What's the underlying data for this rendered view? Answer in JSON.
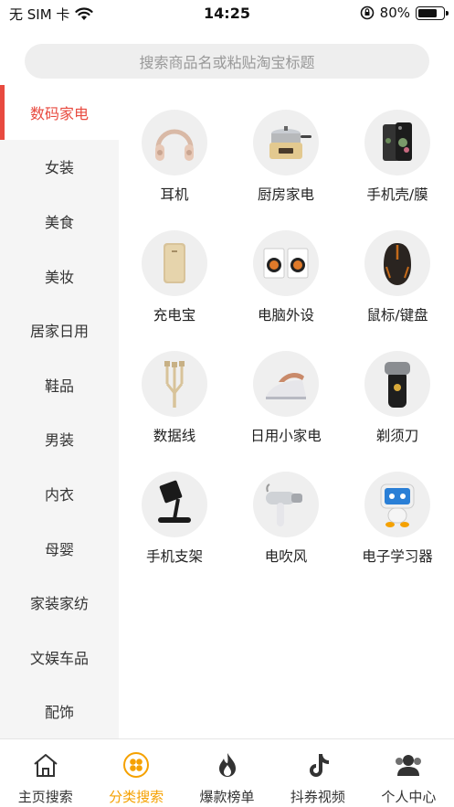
{
  "status_bar": {
    "carrier": "无 SIM 卡",
    "time": "14:25",
    "battery_percent": "80%",
    "battery_level": 0.8
  },
  "search": {
    "placeholder": "搜索商品名或粘贴淘宝标题"
  },
  "sidebar": {
    "items": [
      {
        "label": "数码家电",
        "active": true
      },
      {
        "label": "女装"
      },
      {
        "label": "美食"
      },
      {
        "label": "美妆"
      },
      {
        "label": "居家日用"
      },
      {
        "label": "鞋品"
      },
      {
        "label": "男装"
      },
      {
        "label": "内衣"
      },
      {
        "label": "母婴"
      },
      {
        "label": "家装家纺"
      },
      {
        "label": "文娱车品"
      },
      {
        "label": "配饰"
      }
    ]
  },
  "grid": {
    "items": [
      {
        "label": "耳机",
        "icon": "headphones-icon"
      },
      {
        "label": "厨房家电",
        "icon": "cooker-icon"
      },
      {
        "label": "手机壳/膜",
        "icon": "phone-case-icon"
      },
      {
        "label": "充电宝",
        "icon": "power-bank-icon"
      },
      {
        "label": "电脑外设",
        "icon": "speakers-icon"
      },
      {
        "label": "鼠标/键盘",
        "icon": "mouse-icon"
      },
      {
        "label": "数据线",
        "icon": "cable-icon"
      },
      {
        "label": "日用小家电",
        "icon": "iron-icon"
      },
      {
        "label": "剃须刀",
        "icon": "shaver-icon"
      },
      {
        "label": "手机支架",
        "icon": "phone-stand-icon"
      },
      {
        "label": "电吹风",
        "icon": "hair-dryer-icon"
      },
      {
        "label": "电子学习器",
        "icon": "learning-robot-icon"
      }
    ]
  },
  "tabbar": {
    "tabs": [
      {
        "label": "主页搜索",
        "icon": "home-icon"
      },
      {
        "label": "分类搜索",
        "icon": "category-icon",
        "active": true
      },
      {
        "label": "爆款榜单",
        "icon": "flame-icon"
      },
      {
        "label": "抖券视频",
        "icon": "tiktok-icon"
      },
      {
        "label": "个人中心",
        "icon": "user-icon"
      }
    ]
  },
  "colors": {
    "accent_red": "#e84a3f",
    "accent_orange": "#f5a100"
  }
}
